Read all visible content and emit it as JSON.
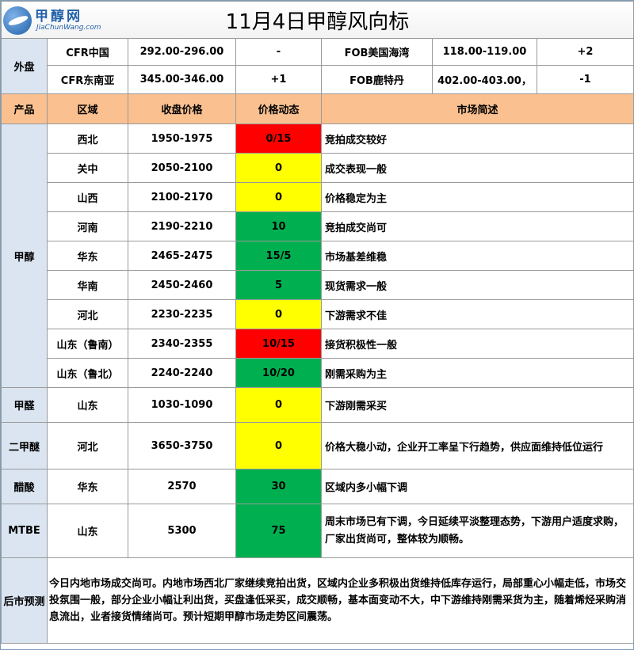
{
  "logo": {
    "name": "甲醇网",
    "site": "JiaChunWang.com"
  },
  "title": "11月4日甲醇风向标",
  "external": {
    "label": "外盘",
    "rows": [
      {
        "a_name": "CFR中国",
        "a_price": "292.00-296.00",
        "a_change": "-",
        "b_name": "FOB美国海湾",
        "b_price": "118.00-119.00",
        "b_change": "+2"
      },
      {
        "a_name": "CFR东南亚",
        "a_price": "345.00-346.00",
        "a_change": "+1",
        "b_name": "FOB鹿特丹",
        "b_price": "402.00-403.00，",
        "b_change": "-1"
      }
    ]
  },
  "headers": {
    "product": "产品",
    "region": "区域",
    "price": "收盘价格",
    "trend": "价格动态",
    "desc": "市场简述"
  },
  "products": [
    {
      "name": "甲醇",
      "rows": [
        {
          "region": "西北",
          "price": "1950-1975",
          "trend": "0/15",
          "color": "#ff0000",
          "desc": "竞拍成交较好"
        },
        {
          "region": "关中",
          "price": "2050-2100",
          "trend": "0",
          "color": "#ffff00",
          "desc": "成交表现一般"
        },
        {
          "region": "山西",
          "price": "2100-2170",
          "trend": "0",
          "color": "#ffff00",
          "desc": "价格稳定为主"
        },
        {
          "region": "河南",
          "price": "2190-2210",
          "trend": "10",
          "color": "#00b050",
          "desc": "竞拍成交尚可"
        },
        {
          "region": "华东",
          "price": "2465-2475",
          "trend": "15/5",
          "color": "#00b050",
          "desc": "市场基差维稳"
        },
        {
          "region": "华南",
          "price": "2450-2460",
          "trend": "5",
          "color": "#00b050",
          "desc": "现货需求一般"
        },
        {
          "region": "河北",
          "price": "2230-2235",
          "trend": "0",
          "color": "#ffff00",
          "desc": "下游需求不佳"
        },
        {
          "region": "山东（鲁南）",
          "price": "2340-2355",
          "trend": "10/15",
          "color": "#ff0000",
          "desc": "接货积极性一般"
        },
        {
          "region": "山东（鲁北）",
          "price": "2240-2240",
          "trend": "10/20",
          "color": "#00b050",
          "desc": "刚需采购为主"
        }
      ]
    },
    {
      "name": "甲醛",
      "rows": [
        {
          "region": "山东",
          "price": "1030-1090",
          "trend": "0",
          "color": "#ffff00",
          "desc": "下游刚需采买"
        }
      ]
    },
    {
      "name": "二甲醚",
      "rows": [
        {
          "region": "河北",
          "price": "3650-3750",
          "trend": "0",
          "color": "#ffff00",
          "desc": "价格大稳小动，企业开工率呈下行趋势，供应面维持低位运行"
        }
      ]
    },
    {
      "name": "醋酸",
      "rows": [
        {
          "region": "华东",
          "price": "2570",
          "trend": "30",
          "color": "#00b050",
          "desc": "区域内多小幅下调"
        }
      ]
    },
    {
      "name": "MTBE",
      "rows": [
        {
          "region": "山东",
          "price": "5300",
          "trend": "75",
          "color": "#00b050",
          "desc": "周末市场已有下调，今日延续平淡整理态势，下游用户适度求购，厂家出货尚可，整体较为顺畅。"
        }
      ]
    }
  ],
  "forecast": {
    "label": "后市预测",
    "text": "今日内地市场成交尚可。内地市场西北厂家继续竞拍出货，区域内企业多积极出货维持低库存运行，局部重心小幅走低，市场交投氛围一般，部分企业小幅让利出货，买盘逢低采买，成交顺畅，基本面变动不大，中下游维持刚需采货为主，随着烯烃采购消息流出，业者接货情绪尚可。预计短期甲醇市场走势区间震荡。"
  }
}
